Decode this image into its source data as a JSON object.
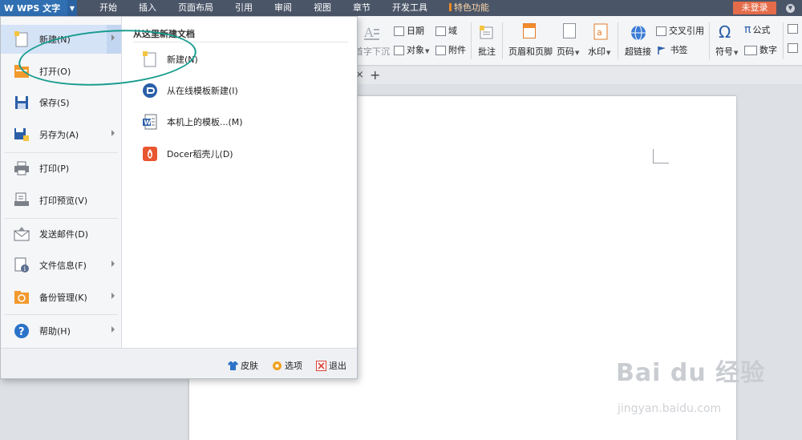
{
  "app": {
    "brand": "WPS 文字",
    "tabs": [
      "开始",
      "插入",
      "页面布局",
      "引用",
      "审阅",
      "视图",
      "章节",
      "开发工具",
      "特色功能"
    ],
    "login": "未登录"
  },
  "ribbon": {
    "date": "日期",
    "field": "域",
    "text_dir": "首字下沉",
    "object": "对象",
    "attachment": "附件",
    "comment": "批注",
    "header_footer": "页眉和页脚",
    "page_num": "页码",
    "watermark": "水印",
    "hyperlink": "超链接",
    "cross_ref": "交叉引用",
    "bookmark": "书签",
    "symbol": "符号",
    "formula": "公式",
    "number": "数字"
  },
  "file_menu": {
    "items": [
      {
        "label": "新建(N)"
      },
      {
        "label": "打开(O)"
      },
      {
        "label": "保存(S)"
      },
      {
        "label": "另存为(A)"
      },
      {
        "label": "打印(P)"
      },
      {
        "label": "打印预览(V)"
      },
      {
        "label": "发送邮件(D)"
      },
      {
        "label": "文件信息(F)"
      },
      {
        "label": "备份管理(K)"
      },
      {
        "label": "帮助(H)"
      }
    ],
    "submenu_title": "从这里新建文档",
    "submenu": [
      {
        "label": "新建(N)"
      },
      {
        "label": "从在线模板新建(I)"
      },
      {
        "label": "本机上的模板...(M)"
      },
      {
        "label": "Docer稻壳儿(D)"
      }
    ],
    "footer": {
      "skin": "皮肤",
      "options": "选项",
      "exit": "退出"
    }
  },
  "watermark": {
    "logo": "Bai du 经验",
    "url": "jingyan.baidu.com"
  },
  "colors": {
    "brand": "#2f6fb2",
    "login": "#e56c4a",
    "annotation": "#169c8e",
    "active": "#d5e3f7"
  }
}
